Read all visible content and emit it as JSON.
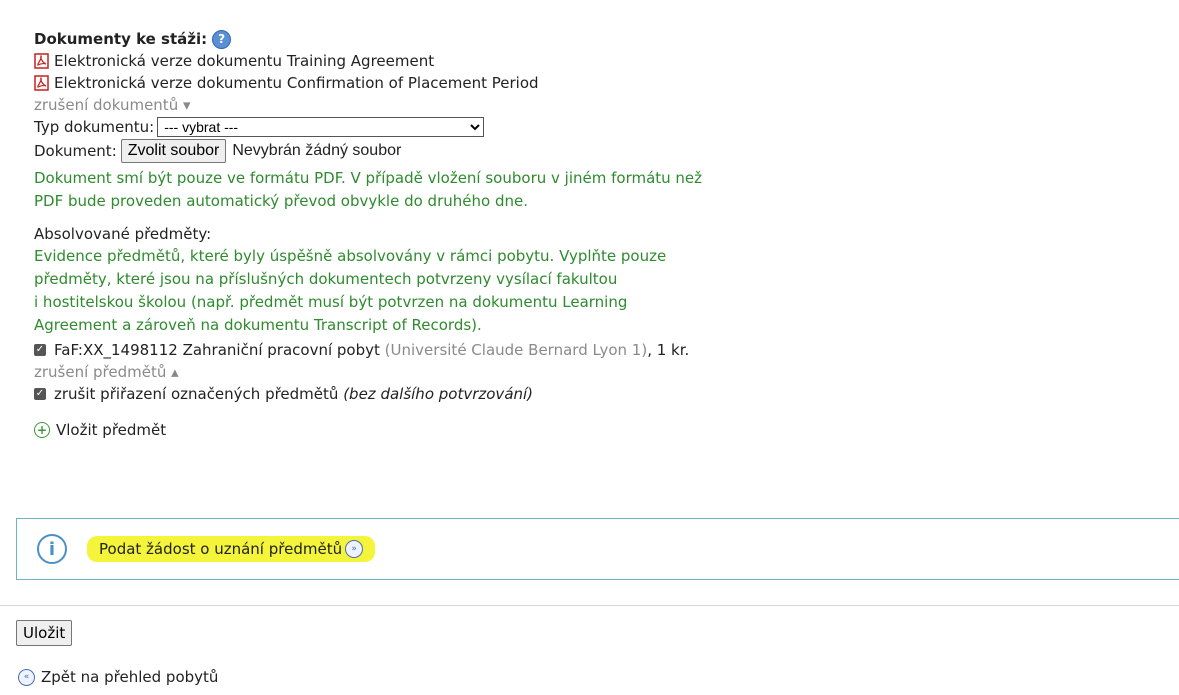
{
  "documents": {
    "heading": "Dokumenty ke stáži:",
    "help_icon": "?",
    "items": [
      {
        "label": "Elektronická verze dokumentu Training Agreement",
        "icon": "pdf-icon"
      },
      {
        "label": "Elektronická verze dokumentu Confirmation of Placement Period",
        "icon": "pdf-icon"
      }
    ],
    "cancel_toggle": "zrušení dokumentů ▾",
    "type_label": "Typ dokumentu:",
    "type_selected": "--- vybrat ---",
    "file_label": "Dokument:",
    "file_button": "Zvolit soubor",
    "file_status": "Nevybrán žádný soubor",
    "note_line1": "Dokument smí být pouze ve formátu PDF. V případě vložení souboru v jiném formátu než",
    "note_line2": "PDF bude proveden automatický převod obvykle do druhého dne."
  },
  "subjects": {
    "heading": "Absolvované předměty:",
    "desc": [
      "Evidence předmětů, které byly úspěšně absolvovány v rámci pobytu. Vyplňte pouze",
      "předměty, které jsou na příslušných dokumentech potvrzeny vysílací fakultou",
      "i hostitelskou školou (např. předmět musí být potvrzen na dokumentu Learning",
      "Agreement a zároveň na dokumentu Transcript of Records)."
    ],
    "item": {
      "code_name": "FaF:XX_1498112 Zahraniční pracovní pobyt",
      "school": "(Université Claude Bernard Lyon 1)",
      "credits": ", 1 kr.",
      "checked": true
    },
    "cancel_toggle": "zrušení předmětů ▴",
    "unassign_label": "zrušit přiřazení označených předmětů",
    "unassign_note": "(bez dalšího potvrzování)",
    "add_label": "Vložit předmět"
  },
  "info": {
    "link_label": "Podat žádost o uznání předmětů",
    "highlight_color": "#f4f43a"
  },
  "actions": {
    "save_label": "Uložit",
    "back_label": "Zpět na přehled pobytů"
  }
}
